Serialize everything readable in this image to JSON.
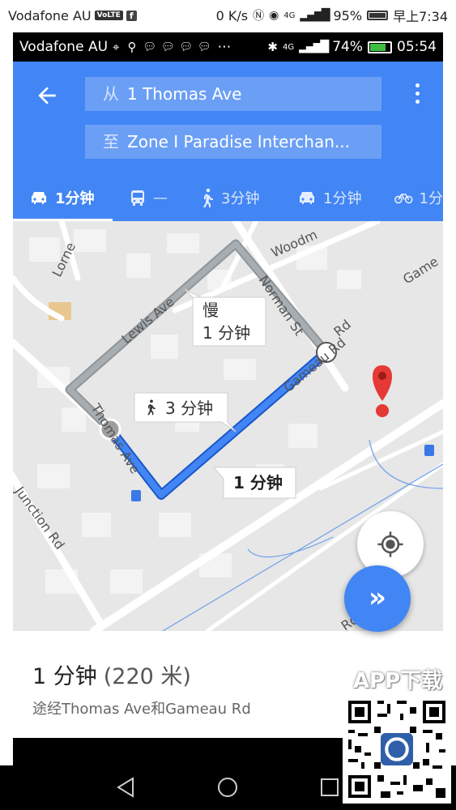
{
  "outer_status": {
    "carrier": "Vodafone AU",
    "volte": "VoLTE",
    "fb": "f",
    "speed": "0 K/s",
    "network": "4G",
    "battery": "95%",
    "time": "早上7:34"
  },
  "inner_status": {
    "carrier": "Vodafone AU",
    "network": "4G",
    "battery": "74%",
    "time": "05:54",
    "battery_color": "#3fbf3f"
  },
  "header": {
    "bg_color": "#4285f4",
    "from_prefix": "从",
    "from_value": "1 Thomas Ave",
    "to_prefix": "至",
    "to_value": "Zone I Paradise Interchan...",
    "back_icon": "arrow-left-icon",
    "more_icon": "more-vert-icon"
  },
  "modes": [
    {
      "icon": "car-icon",
      "label": "1分钟",
      "active": true
    },
    {
      "icon": "bus-icon",
      "label": "—",
      "active": false
    },
    {
      "icon": "walk-icon",
      "label": "3分钟",
      "active": false
    },
    {
      "icon": "taxi-icon",
      "label": "1分钟",
      "active": false
    },
    {
      "icon": "bike-icon",
      "label": "1分",
      "active": false
    }
  ],
  "map": {
    "streets": [
      "Lewis Ave",
      "Woodm",
      "Norman St",
      "Gameau Rd",
      "Game",
      "Rd",
      "Thomas Ave",
      "Junction Rd",
      "Lorne",
      "Rd"
    ],
    "route_colors": {
      "main": "#4285f4",
      "alt": "#a4a9ad"
    },
    "callout_slow": {
      "label": "慢",
      "time": "1 分钟"
    },
    "callout_walk": {
      "time": "3 分钟"
    },
    "callout_main": {
      "time": "1 分钟"
    },
    "destination_color": "#e53935"
  },
  "summary": {
    "time": "1 分钟",
    "distance": "(220 米)",
    "via": "途经Thomas Ave和Gameau Rd"
  },
  "watermark": {
    "text": "APP下载"
  }
}
